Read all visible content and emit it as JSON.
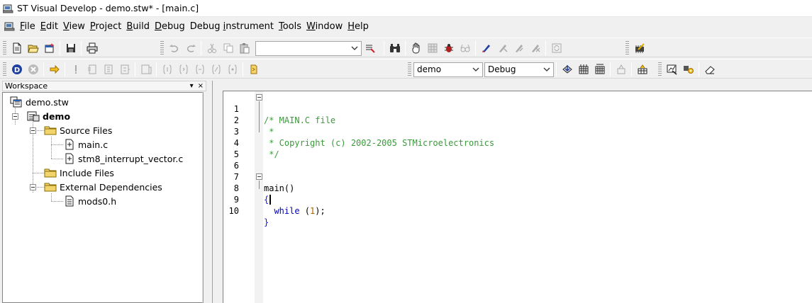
{
  "window": {
    "title": "ST Visual Develop - demo.stw* - [main.c]"
  },
  "menu": [
    {
      "label": "File",
      "u": "F",
      "rest": "ile"
    },
    {
      "label": "Edit",
      "u": "E",
      "rest": "dit"
    },
    {
      "label": "View",
      "u": "V",
      "rest": "iew"
    },
    {
      "label": "Project",
      "u": "P",
      "rest": "roject"
    },
    {
      "label": "Build",
      "u": "B",
      "rest": "uild"
    },
    {
      "label": "Debug",
      "u": "D",
      "rest": "ebug"
    },
    {
      "label": "Debug instrument",
      "pre": "Debug ",
      "u": "i",
      "rest": "nstrument"
    },
    {
      "label": "Tools",
      "u": "T",
      "rest": "ools"
    },
    {
      "label": "Window",
      "u": "W",
      "rest": "indow"
    },
    {
      "label": "Help",
      "u": "H",
      "rest": "elp"
    }
  ],
  "toolbar": {
    "search_value": "",
    "project_combo": "demo",
    "config_combo": "Debug"
  },
  "workspace": {
    "title": "Workspace",
    "pin": "▾",
    "close": "×",
    "tree": [
      {
        "label": "demo.stw",
        "kind": "workspace"
      },
      {
        "label": "demo",
        "kind": "project"
      },
      {
        "label": "Source Files",
        "kind": "folder"
      },
      {
        "label": "main.c",
        "kind": "file"
      },
      {
        "label": "stm8_interrupt_vector.c",
        "kind": "file"
      },
      {
        "label": "Include Files",
        "kind": "folder"
      },
      {
        "label": "External Dependencies",
        "kind": "folder"
      },
      {
        "label": "mods0.h",
        "kind": "file"
      }
    ]
  },
  "editor": {
    "lines": [
      {
        "n": "1",
        "text": "/* MAIN.C file"
      },
      {
        "n": "2",
        "text": " *"
      },
      {
        "n": "3",
        "text": " * Copyright (c) 2002-2005 STMicroelectronics"
      },
      {
        "n": "4",
        "text": " */"
      },
      {
        "n": "5",
        "text": ""
      },
      {
        "n": "6",
        "text": ""
      },
      {
        "n": "7",
        "text": "main()"
      },
      {
        "n": "8",
        "text": "{"
      },
      {
        "n": "9",
        "while": "  while",
        "open": " (",
        "num": "1",
        "close": ");"
      },
      {
        "n": "10",
        "text": "}"
      }
    ]
  }
}
